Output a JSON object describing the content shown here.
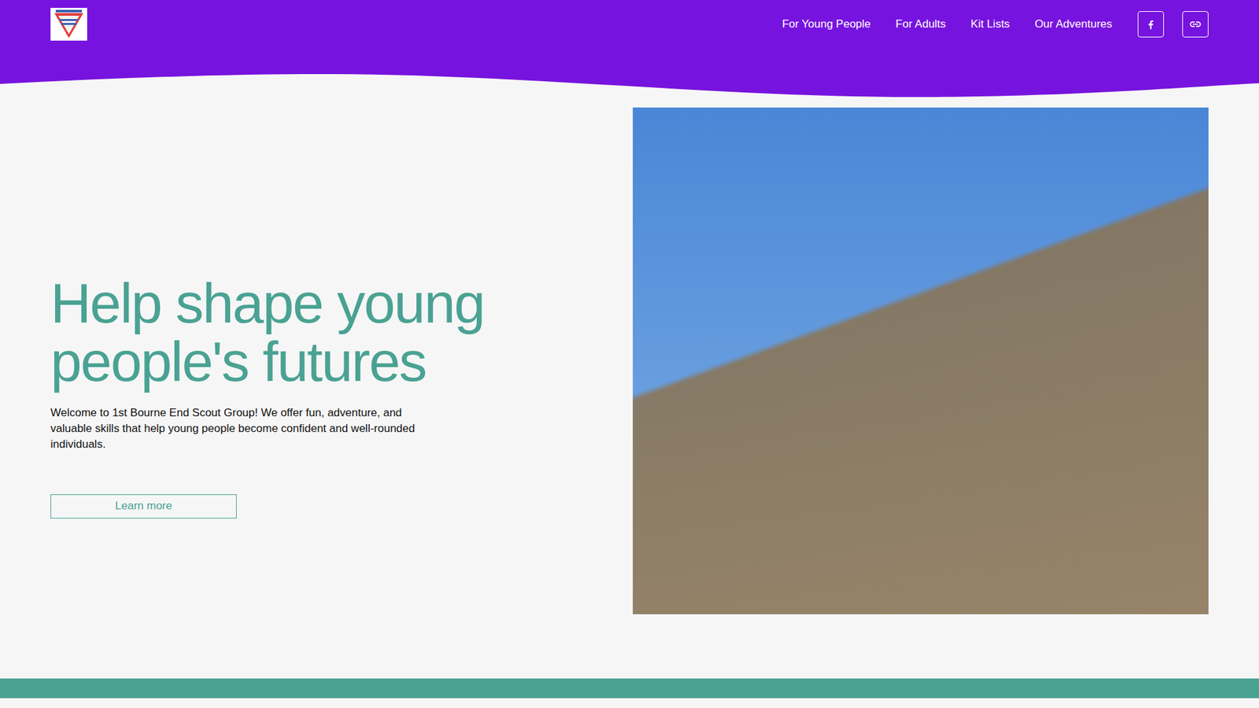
{
  "header": {
    "nav": [
      "For Young People",
      "For Adults",
      "Kit Lists",
      "Our Adventures"
    ],
    "social": [
      {
        "kind": "facebook"
      },
      {
        "kind": "link"
      }
    ]
  },
  "hero": {
    "heading": "Help shape young people's futures",
    "text": "Welcome to 1st Bourne End Scout Group! We offer fun, adventure, and valuable skills that help young people become confident and well-rounded individuals.",
    "button": "Learn more"
  }
}
